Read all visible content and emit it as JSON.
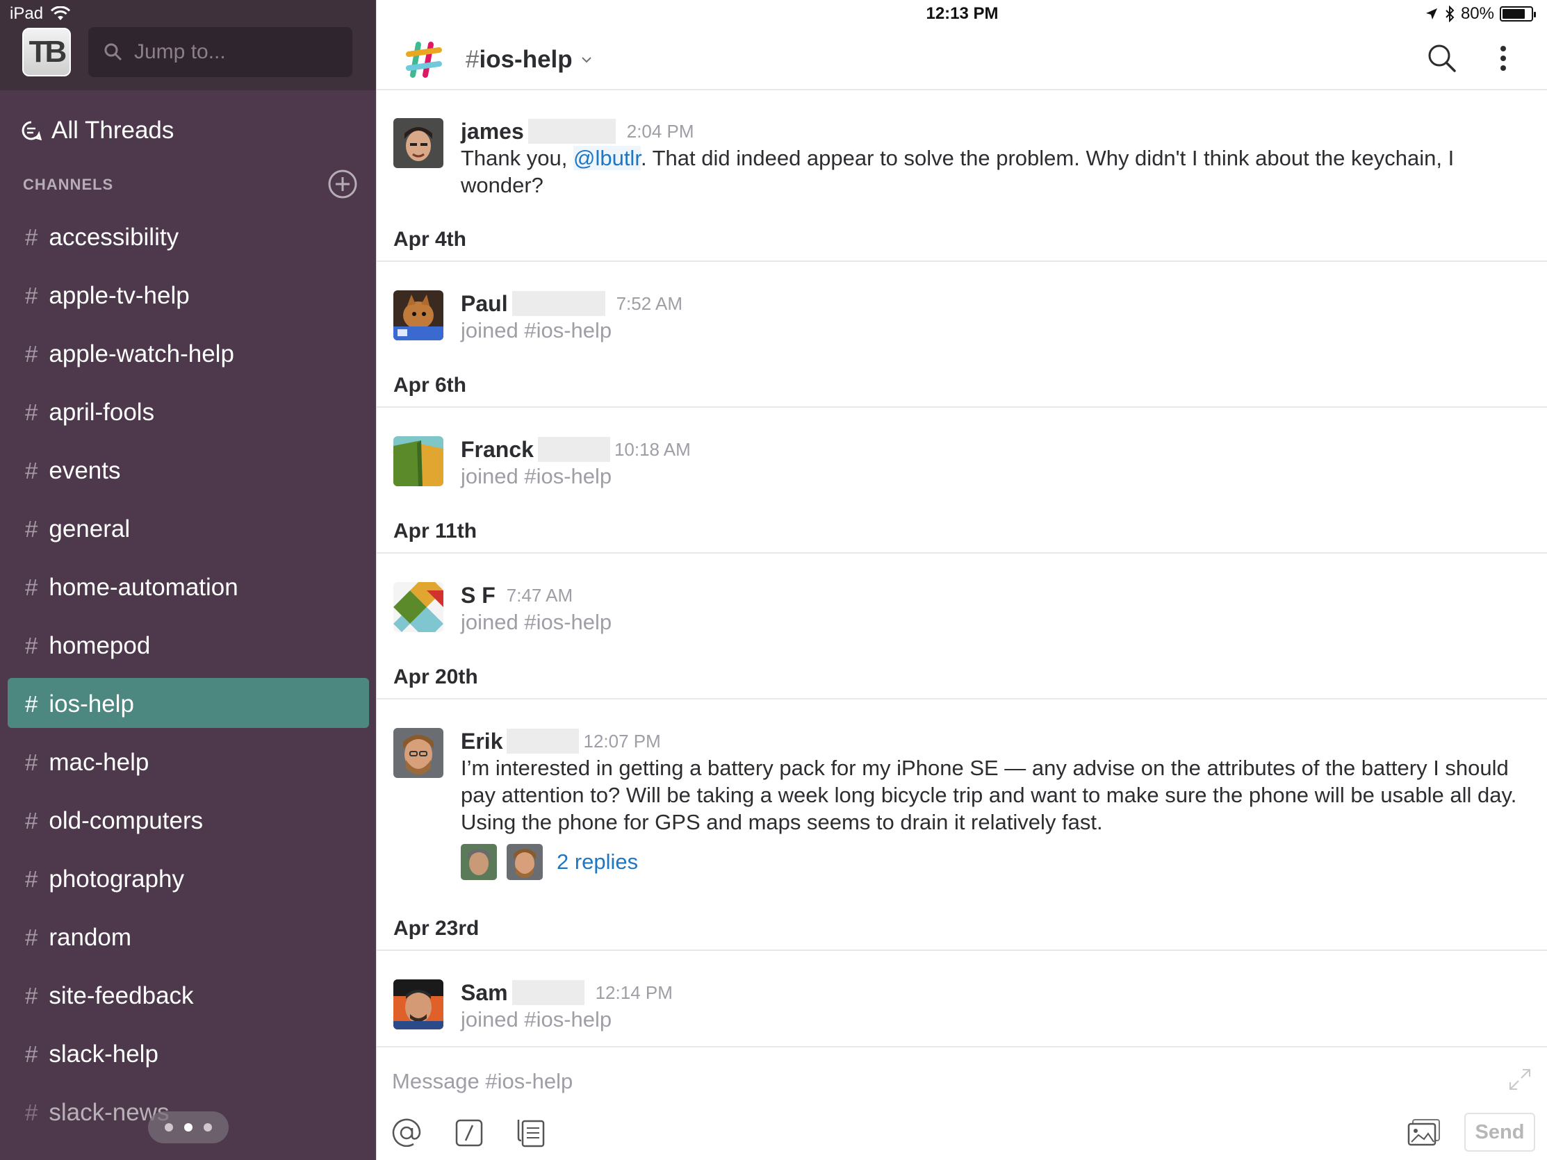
{
  "status_bar": {
    "device": "iPad",
    "time": "12:13 PM",
    "battery": "80%"
  },
  "sidebar": {
    "team_initials": "TB",
    "jump_placeholder": "Jump to...",
    "all_threads": "All Threads",
    "channels_header": "CHANNELS",
    "channels": [
      {
        "name": "accessibility"
      },
      {
        "name": "apple-tv-help"
      },
      {
        "name": "apple-watch-help"
      },
      {
        "name": "april-fools"
      },
      {
        "name": "events"
      },
      {
        "name": "general"
      },
      {
        "name": "home-automation"
      },
      {
        "name": "homepod"
      },
      {
        "name": "ios-help",
        "active": true
      },
      {
        "name": "mac-help"
      },
      {
        "name": "old-computers"
      },
      {
        "name": "photography"
      },
      {
        "name": "random"
      },
      {
        "name": "site-feedback"
      },
      {
        "name": "slack-help"
      },
      {
        "name": "slack-news"
      }
    ],
    "accent_color": "#4c9689",
    "background_color": "#4d394b"
  },
  "header": {
    "hash": "#",
    "channel": "ios-help"
  },
  "messages": {
    "m1": {
      "user": "james",
      "time": "2:04 PM",
      "text_before": "Thank you, ",
      "mention": "@lbutlr",
      "text_after": ". That did indeed appear to solve the problem. Why didn't I think about the keychain, I wonder?"
    },
    "d1": "Apr 4th",
    "m2": {
      "user": "Paul",
      "time": "7:52 AM",
      "text": "joined #ios-help"
    },
    "d2": "Apr 6th",
    "m3": {
      "user": "Franck",
      "time": "10:18 AM",
      "text": "joined #ios-help"
    },
    "d3": "Apr 11th",
    "m4": {
      "user": "S F",
      "time": "7:47 AM",
      "text": "joined #ios-help"
    },
    "d4": "Apr 20th",
    "m5": {
      "user": "Erik",
      "time": "12:07 PM",
      "text": "I’m interested in getting a battery pack for my iPhone SE — any advise on the attributes of the battery I should pay attention to? Will be taking a week long bicycle trip and want to make sure the phone will be usable all day. Using the phone for GPS and maps seems to drain it relatively fast.",
      "replies": "2 replies"
    },
    "d5": "Apr 23rd",
    "m6": {
      "user": "Sam",
      "time": "12:14 PM",
      "text": "joined #ios-help"
    }
  },
  "composer": {
    "placeholder": "Message #ios-help",
    "send": "Send"
  },
  "icons": {
    "wifi": "wifi-icon",
    "search": "search-icon",
    "threads": "threads-icon",
    "add": "plus-circle-icon",
    "more": "vertical-dots-icon",
    "mention": "at-icon",
    "slash": "slash-command-icon",
    "snippet": "snippet-icon",
    "photo": "photo-icon",
    "expand": "expand-icon"
  }
}
